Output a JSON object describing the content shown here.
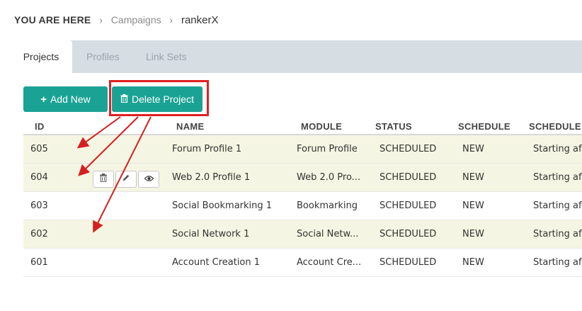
{
  "breadcrumb": {
    "you_are_here": "YOU ARE HERE",
    "separator": "›",
    "items": [
      "Campaigns",
      "rankerX"
    ]
  },
  "tabs": [
    {
      "label": "Projects",
      "active": true
    },
    {
      "label": "Profiles",
      "active": false
    },
    {
      "label": "Link Sets",
      "active": false
    }
  ],
  "toolbar": {
    "add_label": "Add New",
    "add_icon": "+",
    "delete_label": "Delete Project",
    "delete_icon": "trash-icon",
    "button_color": "#1aa394",
    "highlight_color": "#e02020"
  },
  "table": {
    "headers": [
      "ID",
      "NAME",
      "MODULE",
      "STATUS",
      "SCHEDULE",
      "SCHEDULE"
    ],
    "rows": [
      {
        "id": "605",
        "name": "Forum Profile 1",
        "module": "Forum Profile",
        "status": "SCHEDULED",
        "schedule": "NEW",
        "schedule2": "Starting af"
      },
      {
        "id": "604",
        "name": "Web 2.0 Profile 1",
        "module": "Web 2.0 Pro...",
        "status": "SCHEDULED",
        "schedule": "NEW",
        "schedule2": "Starting af"
      },
      {
        "id": "603",
        "name": "Social Bookmarking 1",
        "module": "Bookmarking",
        "status": "SCHEDULED",
        "schedule": "NEW",
        "schedule2": "Starting af"
      },
      {
        "id": "602",
        "name": "Social Network 1",
        "module": "Social Netw...",
        "status": "SCHEDULED",
        "schedule": "NEW",
        "schedule2": "Starting af"
      },
      {
        "id": "601",
        "name": "Account Creation 1",
        "module": "Account Cre...",
        "status": "SCHEDULED",
        "schedule": "NEW",
        "schedule2": "Starting af"
      }
    ],
    "row_actions": [
      "trash-icon",
      "pencil-icon",
      "eye-icon"
    ],
    "selected_row_color": "#f5f5e3"
  }
}
